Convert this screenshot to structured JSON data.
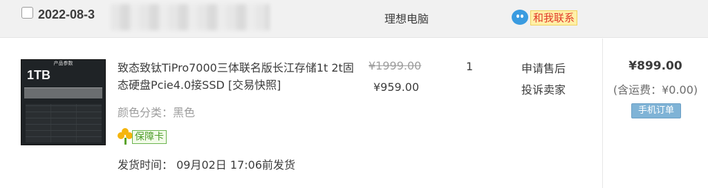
{
  "order": {
    "date": "2022-08-3",
    "shop_name": "理想电脑",
    "chat_label": "和我联系"
  },
  "product": {
    "title": "致态致钛TiPro7000三体联名版长江存储1t 2t固态硬盘Pcie4.0接SSD [交易快照]",
    "image_top_text": "产品参数",
    "image_capacity": "1TB",
    "attribute": "颜色分类：黑色",
    "guarantee_label": "保障卡",
    "ship_time": "发货时间：  09月02日 17:06前发货"
  },
  "pricing": {
    "original": "¥1999.00",
    "current": "¥959.00",
    "quantity": "1"
  },
  "service": {
    "link1": "申请售后",
    "link2": "投诉卖家"
  },
  "total": {
    "amount": "¥899.00",
    "shipping_note": "(含运费：¥0.00)",
    "mobile_order_tag": "手机订单"
  },
  "colors": {
    "header_bg": "#f1f1f1",
    "chat_label_bg": "#fff0a8",
    "chat_label_text": "#e13a2a",
    "guarantee_green": "#4d9d2a",
    "mobile_tag_bg": "#7fb3d6"
  }
}
